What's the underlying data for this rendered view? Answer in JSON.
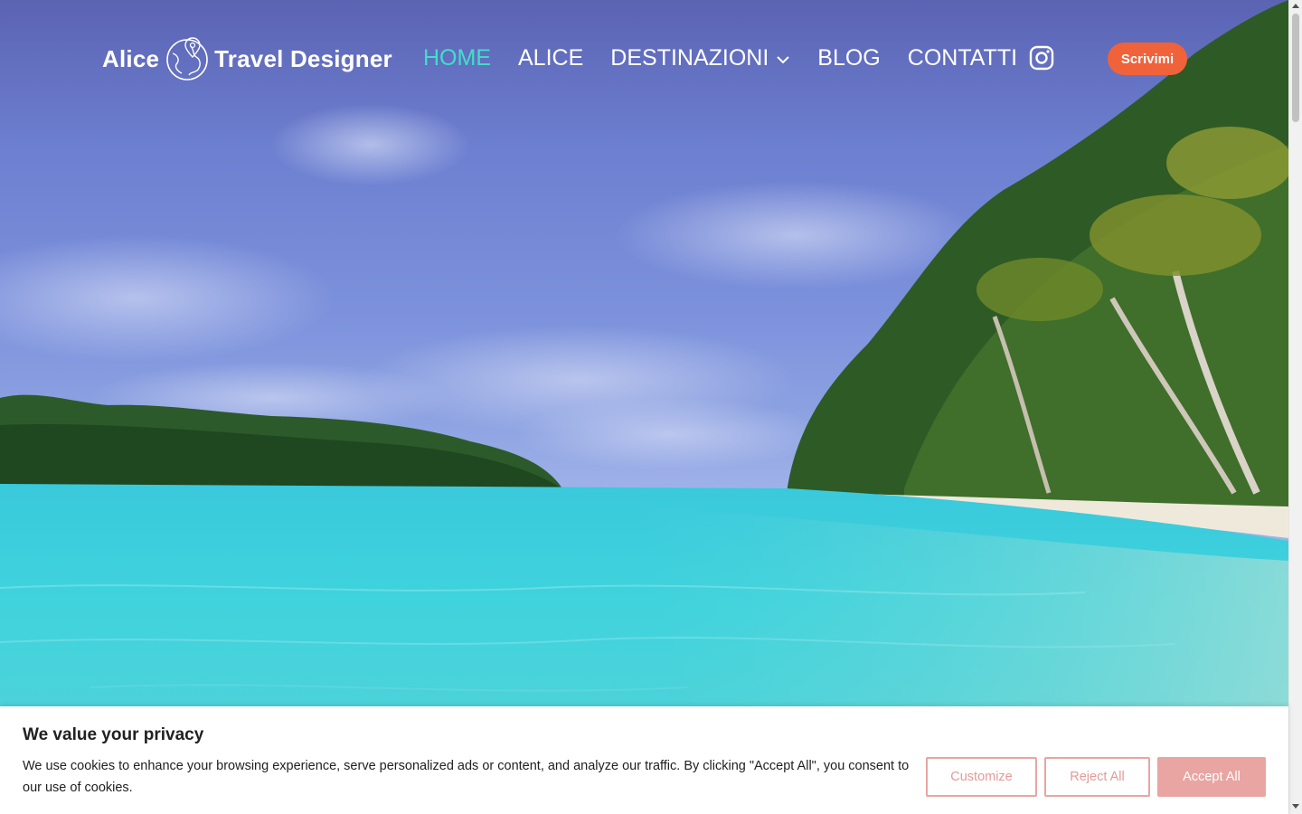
{
  "header": {
    "logo_left": "Alice",
    "logo_right": "Travel Designer",
    "nav": [
      {
        "label": "HOME",
        "active": true
      },
      {
        "label": "ALICE",
        "active": false
      },
      {
        "label": "DESTINAZIONI",
        "active": false,
        "has_dropdown": true
      },
      {
        "label": "BLOG",
        "active": false
      },
      {
        "label": "CONTATTI",
        "active": false
      }
    ],
    "social_icon": "instagram-icon",
    "cta_label": "Scrivimi"
  },
  "cookie_banner": {
    "title": "We value your privacy",
    "text": "We use cookies to enhance your browsing experience, serve personalized ads or content, and analyze our traffic. By clicking \"Accept All\", you consent to our use of cookies.",
    "customize_label": "Customize",
    "reject_label": "Reject All",
    "accept_label": "Accept All"
  },
  "colors": {
    "nav_active": "#3fe0c8",
    "cta_bg": "#f0623a",
    "cookie_accent": "#e9a5a2"
  }
}
